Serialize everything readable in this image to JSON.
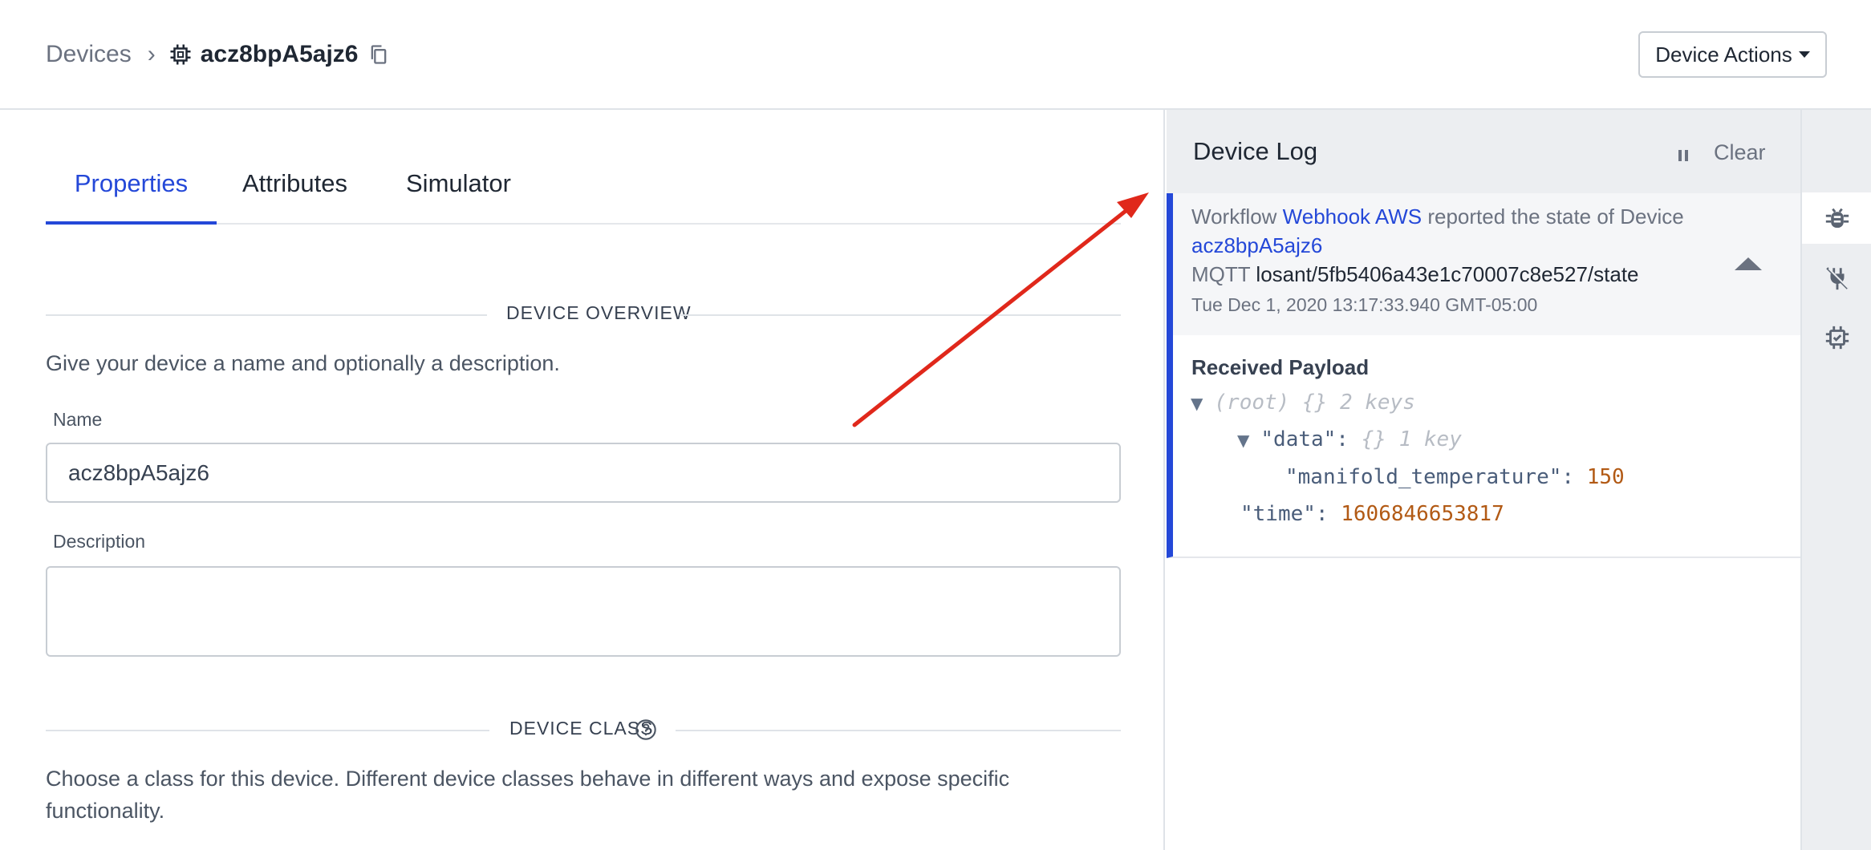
{
  "header": {
    "breadcrumb_root": "Devices",
    "breadcrumb_separator": "›",
    "device_name": "acz8bpA5ajz6",
    "device_actions_label": "Device Actions"
  },
  "tabs": [
    {
      "label": "Properties",
      "active": true
    },
    {
      "label": "Attributes",
      "active": false
    },
    {
      "label": "Simulator",
      "active": false
    }
  ],
  "overview": {
    "section_title": "DEVICE OVERVIEW",
    "intro": "Give your device a name and optionally a description.",
    "name_label": "Name",
    "name_value": "acz8bpA5ajz6",
    "description_label": "Description",
    "description_value": ""
  },
  "device_class": {
    "section_title": "DEVICE CLASS",
    "intro_line1": "Choose a class for this device. Different device classes behave in different ways and expose specific",
    "intro_line2": "functionality."
  },
  "log": {
    "title": "Device Log",
    "clear_label": "Clear",
    "entry": {
      "prefix": "Workflow",
      "workflow_name": "Webhook AWS",
      "middle": "reported the state of Device",
      "device_link": "acz8bpA5ajz6",
      "protocol": "MQTT",
      "topic": "losant/5fb5406a43e1c70007c8e527/state",
      "timestamp": "Tue Dec 1, 2020 13:17:33.940 GMT-05:00",
      "payload_title": "Received Payload",
      "tree": {
        "root_label": "(root)",
        "root_meta": "{}",
        "root_count": "2 keys",
        "data_key": "\"data\":",
        "data_meta": "{}",
        "data_count": "1 key",
        "temp_key": "\"manifold_temperature\":",
        "temp_value": "150",
        "time_key": "\"time\":",
        "time_value": "1606846653817"
      }
    }
  },
  "rail": [
    {
      "icon": "bug-icon",
      "active": true
    },
    {
      "icon": "plug-icon",
      "active": false
    },
    {
      "icon": "device-chip-icon",
      "active": false
    }
  ],
  "colors": {
    "accent": "#2448d8",
    "annotation_arrow": "#e0281b",
    "number": "#b25a15"
  }
}
